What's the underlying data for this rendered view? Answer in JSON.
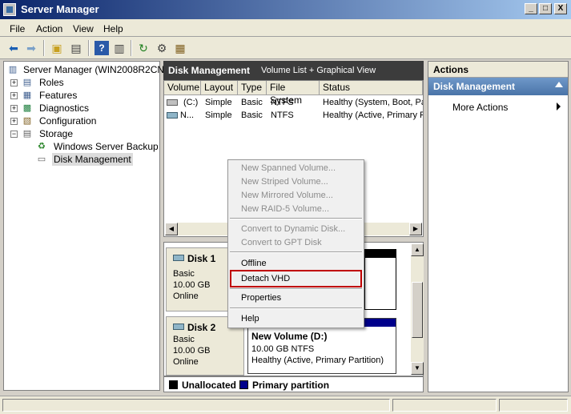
{
  "window": {
    "title": "Server Manager",
    "controls": {
      "minimize": "_",
      "restore": "□",
      "close": "X"
    }
  },
  "menu": [
    "File",
    "Action",
    "View",
    "Help"
  ],
  "toolbar_icons": [
    "back-icon",
    "forward-icon",
    "up-folder-icon",
    "show-hide-tree-icon",
    "help-icon",
    "show-hide-action-pane-icon",
    "refresh-icon",
    "properties-icon",
    "export-icon"
  ],
  "tree": {
    "root": "Server Manager (WIN2008R2CN)",
    "items": [
      {
        "label": "Roles",
        "expander": "+"
      },
      {
        "label": "Features",
        "expander": "+"
      },
      {
        "label": "Diagnostics",
        "expander": "+"
      },
      {
        "label": "Configuration",
        "expander": "+"
      },
      {
        "label": "Storage",
        "expander": "−"
      }
    ],
    "children": [
      "Windows Server Backup",
      "Disk Management"
    ]
  },
  "center": {
    "header_title": "Disk Management",
    "header_sub": "Volume List + Graphical View",
    "columns": [
      "Volume",
      "Layout",
      "Type",
      "File System",
      "Status"
    ],
    "rows": [
      {
        "volume": "(C:)",
        "layout": "Simple",
        "type": "Basic",
        "fs": "NTFS",
        "status": "Healthy (System, Boot, Pa"
      },
      {
        "volume": "N...",
        "layout": "Simple",
        "type": "Basic",
        "fs": "NTFS",
        "status": "Healthy (Active, Primary P"
      }
    ]
  },
  "disks": [
    {
      "name": "Disk 1",
      "type": "Basic",
      "size": "10.00 GB",
      "state": "Online"
    },
    {
      "name": "Disk 2",
      "type": "Basic",
      "size": "10.00 GB",
      "state": "Online",
      "volume": {
        "name": "New Volume  (D:)",
        "size": "10.00 GB NTFS",
        "status": "Healthy (Active, Primary Partition)"
      }
    }
  ],
  "legend": {
    "unallocated": "Unallocated",
    "primary": "Primary partition",
    "colors": {
      "unallocated": "#000000",
      "primary": "#00008b"
    }
  },
  "actions": {
    "header": "Actions",
    "section": "Disk Management",
    "more": "More Actions"
  },
  "context_menu": {
    "items": [
      {
        "label": "New Spanned Volume...",
        "enabled": false
      },
      {
        "label": "New Striped Volume...",
        "enabled": false
      },
      {
        "label": "New Mirrored Volume...",
        "enabled": false
      },
      {
        "label": "New RAID-5 Volume...",
        "enabled": false
      },
      {
        "label": "Convert to Dynamic Disk...",
        "enabled": false
      },
      {
        "label": "Convert to GPT Disk",
        "enabled": false
      },
      {
        "label": "Offline",
        "enabled": true
      },
      {
        "label": "Detach VHD",
        "enabled": true,
        "highlighted": true
      },
      {
        "label": "Properties",
        "enabled": true
      },
      {
        "label": "Help",
        "enabled": true
      }
    ],
    "highlight_color": "#c00000"
  }
}
